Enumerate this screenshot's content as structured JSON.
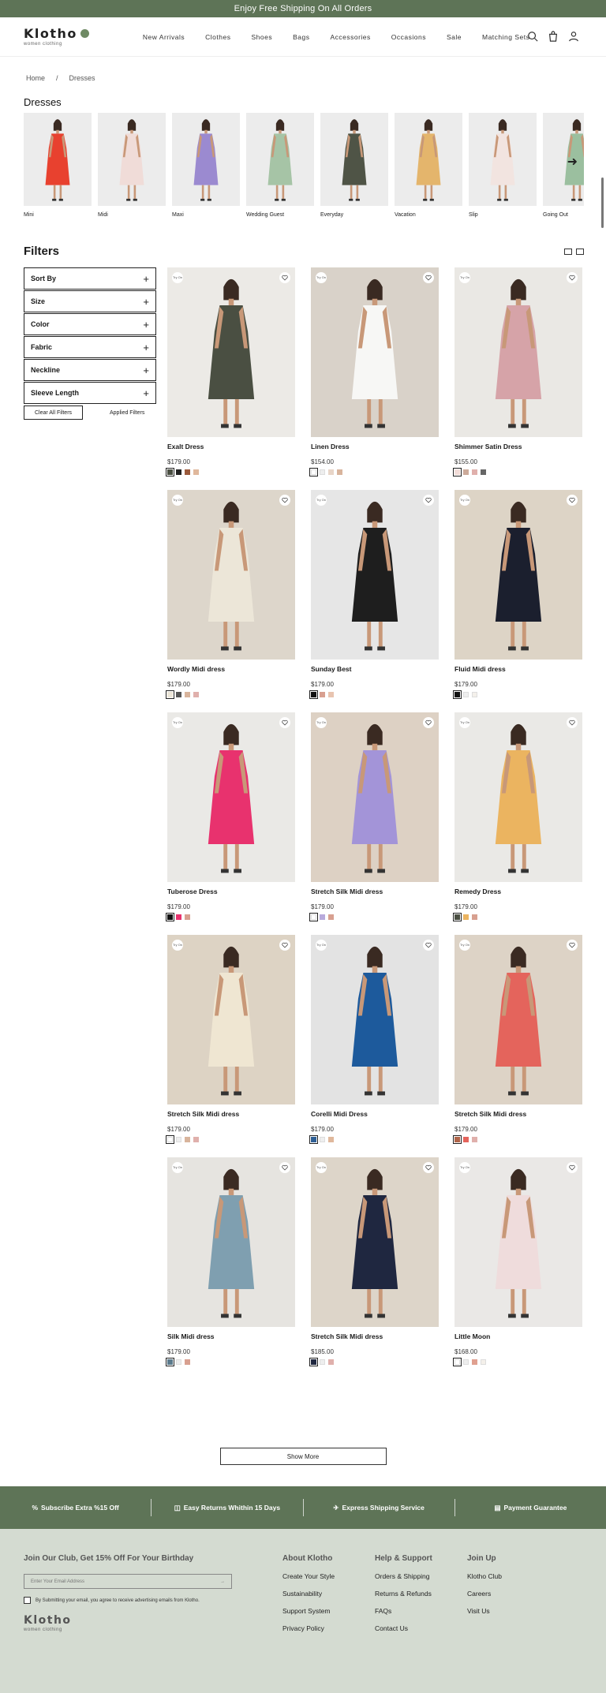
{
  "promo_bar": "Enjoy Free Shipping On All Orders",
  "brand": {
    "name": "Klotho",
    "tagline": "women clothing"
  },
  "nav": [
    "New Arrivals",
    "Clothes",
    "Shoes",
    "Bags",
    "Accessories",
    "Occasions",
    "Sale",
    "Matching Sets"
  ],
  "breadcrumb": [
    "Home",
    "/",
    "Dresses"
  ],
  "category_title": "Dresses",
  "categories": [
    {
      "label": "Mini",
      "color": "#e8412f"
    },
    {
      "label": "Midi",
      "color": "#f0dcd8"
    },
    {
      "label": "Maxi",
      "color": "#9b8ad0"
    },
    {
      "label": "Wedding Guest",
      "color": "#a6c4a6"
    },
    {
      "label": "Everyday",
      "color": "#4f5446"
    },
    {
      "label": "Vacation",
      "color": "#e4b56c"
    },
    {
      "label": "Slip",
      "color": "#f2e4e0"
    },
    {
      "label": "Going Out",
      "color": "#9bbf9f"
    }
  ],
  "filters_title": "Filters",
  "filters": [
    "Sort By",
    "Size",
    "Color",
    "Fabric",
    "Neckline",
    "Sleeve Length"
  ],
  "clear_all": "Clear All Filters",
  "applied_filters": "Applied Filters",
  "badge_text": "Try On",
  "products": [
    {
      "name": "Exalt Dress",
      "price": "$179.00",
      "dress": "#4a4f42",
      "bg": "#eceae6",
      "swatches": [
        "#4a4f42",
        "#222222",
        "#9b5a3c",
        "#e0b89c"
      ]
    },
    {
      "name": "Linen Dress",
      "price": "$154.00",
      "dress": "#f7f7f5",
      "bg": "#d9d2c9",
      "swatches": [
        "#ffffff",
        "#eeeeee",
        "#e8d5c8",
        "#d8b49c"
      ]
    },
    {
      "name": "Shimmer Satin Dress",
      "price": "$155.00",
      "dress": "#d6a3a8",
      "bg": "#eae8e4",
      "swatches": [
        "#f2dcd8",
        "#ccaa9a",
        "#e0b0ac",
        "#666666"
      ]
    },
    {
      "name": "Wordly Midi dress",
      "price": "$179.00",
      "dress": "#ece6d8",
      "bg": "#ddd6cb",
      "swatches": [
        "#ece6d8",
        "#555555",
        "#d8b49c",
        "#e0b0ac"
      ]
    },
    {
      "name": "Sunday Best",
      "price": "$179.00",
      "dress": "#1e1e1e",
      "bg": "#e6e6e6",
      "swatches": [
        "#111111",
        "#d8a090",
        "#e8c4b0"
      ]
    },
    {
      "name": "Fluid Midi dress",
      "price": "$179.00",
      "dress": "#1b1f2e",
      "bg": "#ddd4c6",
      "swatches": [
        "#111111",
        "#eeeeee",
        "#f4f0ea"
      ]
    },
    {
      "name": "Tuberose Dress",
      "price": "$179.00",
      "dress": "#e8326e",
      "bg": "#eae9e6",
      "swatches": [
        "#111111",
        "#e8326e",
        "#d8a090"
      ]
    },
    {
      "name": "Stretch Silk Midi dress",
      "price": "$179.00",
      "dress": "#a394d8",
      "bg": "#ddd1c4",
      "swatches": [
        "#ffffff",
        "#b8aadc",
        "#d8a090"
      ]
    },
    {
      "name": "Remedy Dress",
      "price": "$179.00",
      "dress": "#ebb460",
      "bg": "#eae9e6",
      "swatches": [
        "#4a4f42",
        "#ebb460",
        "#d8a090"
      ]
    },
    {
      "name": "Stretch Silk Midi dress",
      "price": "$179.00",
      "dress": "#efe6d2",
      "bg": "#ddd3c4",
      "swatches": [
        "#ffffff",
        "#eeeeee",
        "#d8b49c",
        "#e0b0ac"
      ]
    },
    {
      "name": "Corelli Midi Dress",
      "price": "$179.00",
      "dress": "#1d5a9c",
      "bg": "#e3e3e3",
      "swatches": [
        "#2e5f95",
        "#eeeeee",
        "#e0b89c"
      ]
    },
    {
      "name": "Stretch Silk Midi dress",
      "price": "$179.00",
      "dress": "#e4645c",
      "bg": "#ddd3c6",
      "swatches": [
        "#b0654a",
        "#e4645c",
        "#e0b0ac"
      ]
    },
    {
      "name": "Silk Midi dress",
      "price": "$179.00",
      "dress": "#7f9fb0",
      "bg": "#e6e4e0",
      "swatches": [
        "#5b7a8c",
        "#eeeeee",
        "#d8a090"
      ]
    },
    {
      "name": "Stretch Silk Midi dress",
      "price": "$185.00",
      "dress": "#1f2740",
      "bg": "#ddd5c9",
      "swatches": [
        "#1f2740",
        "#eeeeee",
        "#e0b0ac"
      ]
    },
    {
      "name": "Little Moon",
      "price": "$168.00",
      "dress": "#efdcdc",
      "bg": "#eae8e6",
      "swatches": [
        "#ffffff",
        "#eeeeee",
        "#e0a090",
        "#f4f0ea"
      ]
    }
  ],
  "show_more": "Show More",
  "benefits": [
    {
      "icon": "percent-icon",
      "label": "Subscribe Extra %15 Off"
    },
    {
      "icon": "box-icon",
      "label": "Easy Returns Whithin 15 Days"
    },
    {
      "icon": "plane-icon",
      "label": "Express Shipping Service"
    },
    {
      "icon": "card-icon",
      "label": "Payment Guarantee"
    }
  ],
  "footer": {
    "club_title": "Join Our Club, Get 15% Off For Your Birthday",
    "email_placeholder": "Enter Your Email Address",
    "consent": "By Submitting your email, you agree to receive advertising emails from Klotho.",
    "columns": [
      {
        "title": "About Klotho",
        "links": [
          "Create Your Style",
          "Sustainability",
          "Support System",
          "Privacy Policy"
        ]
      },
      {
        "title": "Help & Support",
        "links": [
          "Orders & Shipping",
          "Returns & Refunds",
          "FAQs",
          "Contact Us"
        ]
      },
      {
        "title": "Join Up",
        "links": [
          "Klotho Club",
          "Careers",
          "Visit Us"
        ]
      }
    ]
  },
  "colors": {
    "brand_green": "#5e7457",
    "footer_bg": "#d4dbd1"
  }
}
